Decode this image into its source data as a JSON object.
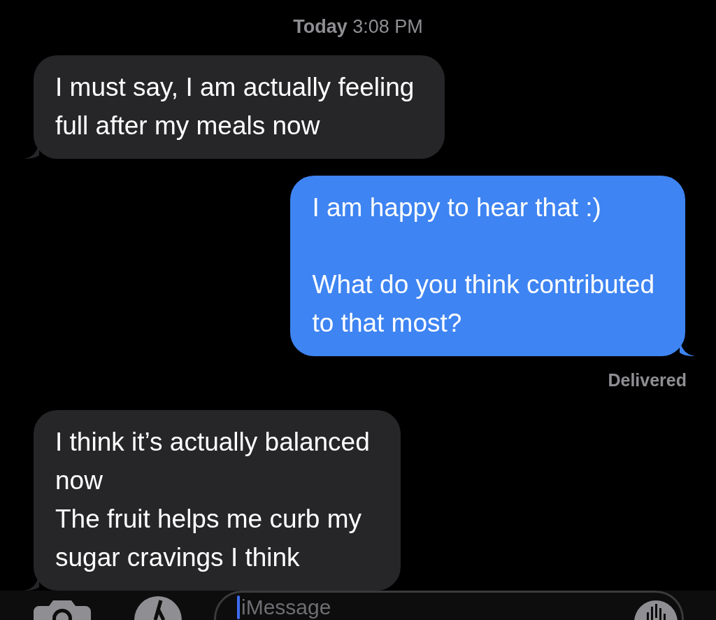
{
  "timestamp": "**Today** 3:08 PM",
  "messages": [
    {
      "kind": "received",
      "text": "I must say, I am actually feeling\nfull after my meals now"
    },
    {
      "kind": "sent",
      "text": "I am happy to hear that :)\n\nWhat do you think contributed\nto that most?",
      "status": "Delivered"
    },
    {
      "kind": "received",
      "text": "I think it’s actually balanced\nnow\nThe fruit helps me curb my\nsugar cravings I think"
    }
  ],
  "composer": {
    "placeholder": "iMessage"
  }
}
